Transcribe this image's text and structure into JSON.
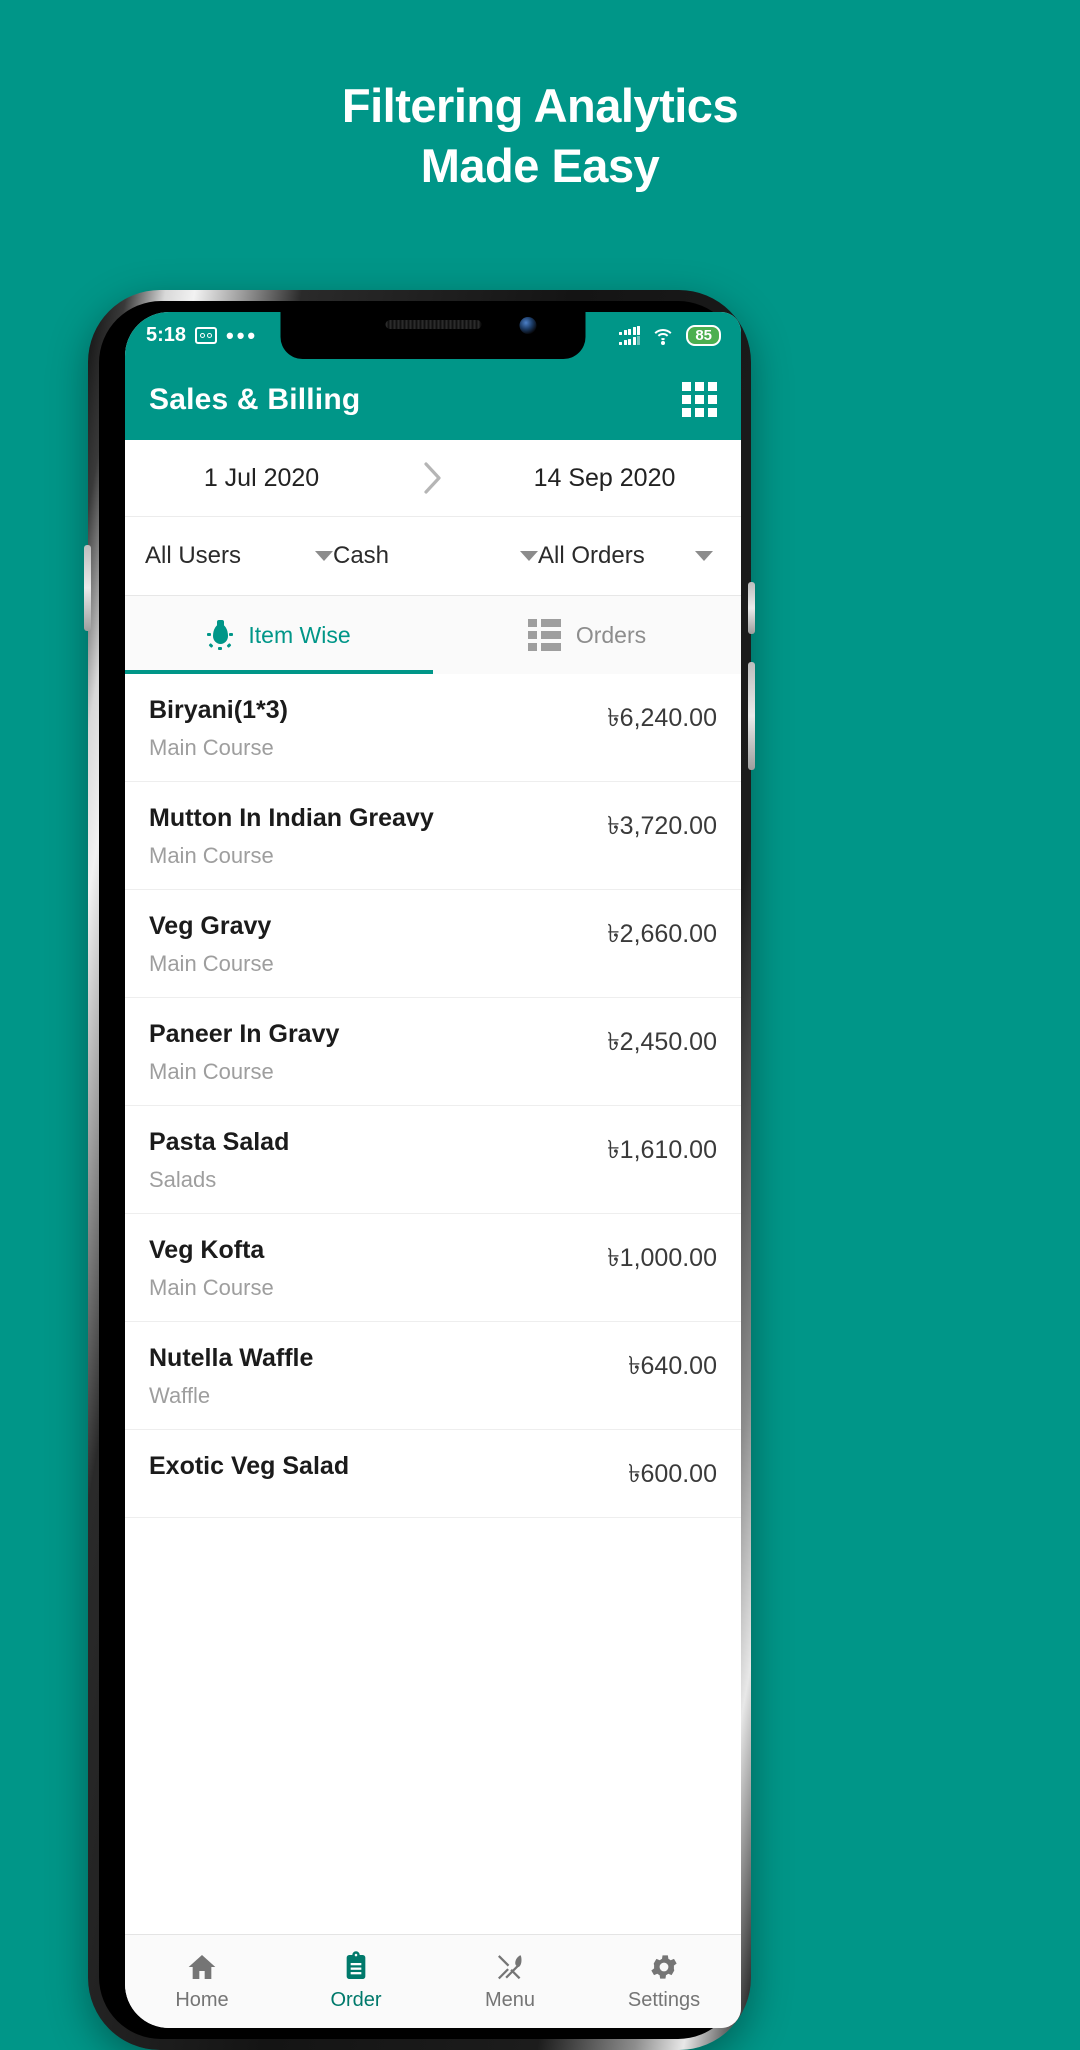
{
  "promo": {
    "line1": "Filtering Analytics",
    "line2": "Made Easy"
  },
  "colors": {
    "brand": "#009688",
    "brand_dark": "#00796b",
    "battery_green": "#4caf50",
    "muted": "#9e9e9e"
  },
  "status_bar": {
    "time": "5:18",
    "voicemail_icon": "voicemail-icon",
    "overflow_dots": "•••",
    "signal_icon": "signal-bars-icon",
    "wifi_icon": "wifi-icon",
    "battery_level": "85"
  },
  "app_bar": {
    "title": "Sales & Billing",
    "grid_icon": "grid-menu-icon"
  },
  "date_range": {
    "from": "1 Jul 2020",
    "to": "14 Sep 2020",
    "arrow_icon": "chevron-right-icon"
  },
  "filters": [
    {
      "label": "All Users",
      "icon": "chevron-down-icon"
    },
    {
      "label": "Cash",
      "icon": "chevron-down-icon"
    },
    {
      "label": "All Orders",
      "icon": "chevron-down-icon"
    }
  ],
  "tabs": [
    {
      "label": "Item Wise",
      "icon": "lightbulb-icon",
      "active": true
    },
    {
      "label": "Orders",
      "icon": "list-icon",
      "active": false
    }
  ],
  "items": [
    {
      "name": "Biryani(1*3)",
      "category": "Main Course",
      "price": "৳6,240.00"
    },
    {
      "name": "Mutton In Indian Greavy",
      "category": "Main Course",
      "price": "৳3,720.00"
    },
    {
      "name": "Veg Gravy",
      "category": "Main Course",
      "price": "৳2,660.00"
    },
    {
      "name": "Paneer In Gravy",
      "category": "Main Course",
      "price": "৳2,450.00"
    },
    {
      "name": "Pasta Salad",
      "category": "Salads",
      "price": "৳1,610.00"
    },
    {
      "name": "Veg Kofta",
      "category": "Main Course",
      "price": "৳1,000.00"
    },
    {
      "name": "Nutella Waffle",
      "category": "Waffle",
      "price": "৳640.00"
    },
    {
      "name": "Exotic Veg Salad",
      "category": "",
      "price": "৳600.00"
    }
  ],
  "bottom_nav": [
    {
      "label": "Home",
      "icon": "home-icon",
      "active": false
    },
    {
      "label": "Order",
      "icon": "clipboard-icon",
      "active": true
    },
    {
      "label": "Menu",
      "icon": "cutlery-icon",
      "active": false
    },
    {
      "label": "Settings",
      "icon": "gear-icon",
      "active": false
    }
  ]
}
